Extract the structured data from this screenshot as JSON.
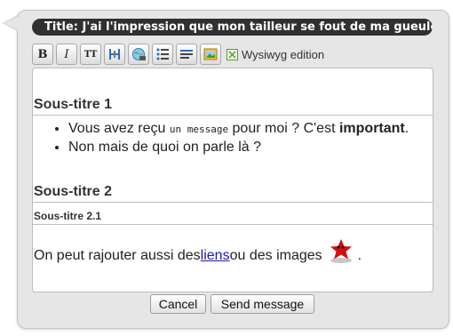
{
  "title": "Title: J'ai l'impression que mon tailleur se fout de ma gueule...",
  "toolbar": {
    "bold_label": "B",
    "italic_label": "I",
    "tt_label": "TT",
    "wysiwyg_label": "Wysiwyg edition"
  },
  "editor": {
    "heading1": "Sous-titre 1",
    "list": [
      {
        "before": "Vous avez reçu ",
        "code": "un message",
        "middle": " pour moi ? C'est ",
        "strong": "important",
        "after": "."
      },
      {
        "text": "Non mais de quoi on parle là ?"
      }
    ],
    "heading2": "Sous-titre 2",
    "heading3": "Sous-titre 2.1",
    "paragraph": {
      "before": "On peut rajouter aussi des ",
      "link": "liens",
      "middle": " ou des images",
      "after": "."
    }
  },
  "buttons": {
    "cancel": "Cancel",
    "send": "Send message"
  },
  "colors": {
    "title_bar": "#303030",
    "bubble_bg": "#e6e6e6",
    "link": "#1a1aa6",
    "star": "#d01010"
  }
}
